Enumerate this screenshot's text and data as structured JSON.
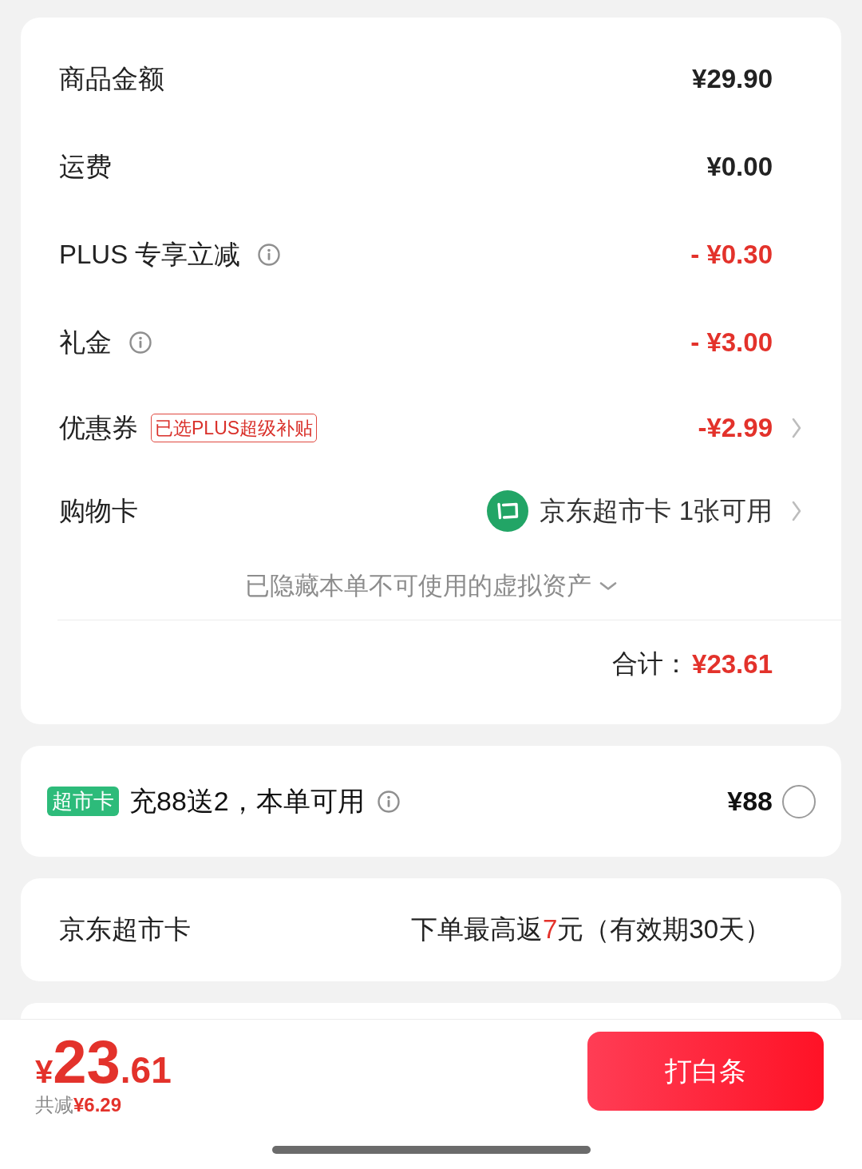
{
  "summary": {
    "rows": [
      {
        "kind": "amount",
        "label": "商品金额",
        "info": false,
        "value": "¥29.90",
        "discount": false,
        "link": false
      },
      {
        "kind": "amount",
        "label": "运费",
        "info": false,
        "value": "¥0.00",
        "discount": false,
        "link": false
      },
      {
        "kind": "amount",
        "label": "PLUS 专享立减",
        "info": true,
        "value": "- ¥0.30",
        "discount": true,
        "link": false
      },
      {
        "kind": "amount",
        "label": "礼金",
        "info": true,
        "value": "- ¥3.00",
        "discount": true,
        "link": false
      },
      {
        "kind": "coupon",
        "label": "优惠券",
        "info": false,
        "tag": "已选PLUS超级补贴",
        "value": "-¥2.99",
        "discount": true,
        "link": true
      },
      {
        "kind": "card",
        "label": "购物卡",
        "info": false,
        "card_name": "京东超市卡 1张可用",
        "link": true
      }
    ],
    "hidden_assets": {
      "text": "已隐藏本单不可使用的虚拟资产",
      "expanded": false
    },
    "total": {
      "label": "合计：",
      "value": "¥23.61"
    }
  },
  "recharge_offer": {
    "badge": "超市卡",
    "text": "充88送2，本单可用",
    "info": true,
    "price": "¥88",
    "selected": false
  },
  "rebate": {
    "label": "京东超市卡",
    "note": {
      "before": "下单最高返",
      "highlight": "7",
      "after": "元（有效期30天）"
    }
  },
  "checkout_bar": {
    "total": {
      "currency": "¥",
      "integer": "23",
      "decimal": ".61"
    },
    "savings": {
      "label": "共减",
      "amount": "¥6.29"
    },
    "button": "打白条"
  }
}
